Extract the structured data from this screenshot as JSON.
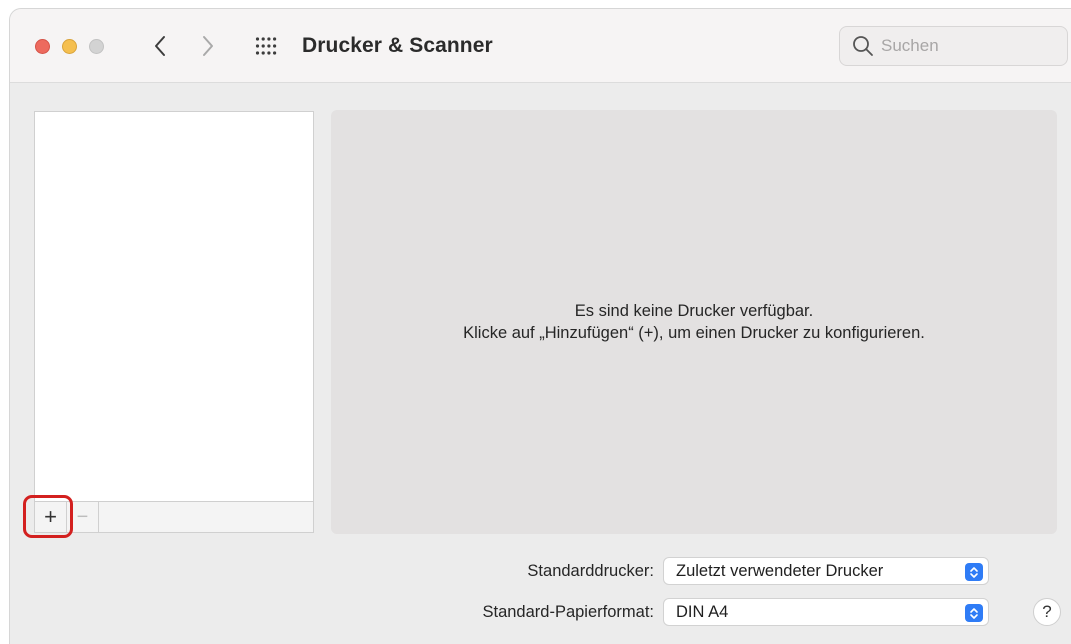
{
  "window": {
    "title": "Drucker & Scanner"
  },
  "search": {
    "placeholder": "Suchen"
  },
  "list_toolbar": {
    "add_label": "+",
    "remove_label": "−"
  },
  "detail": {
    "line1": "Es sind keine Drucker verfügbar.",
    "line2": "Klicke auf „Hinzufügen“ (+), um einen Drucker zu konfigurieren."
  },
  "settings": {
    "default_printer_label": "Standarddrucker:",
    "default_printer_value": "Zuletzt verwendeter Drucker",
    "paper_size_label": "Standard-Papierformat:",
    "paper_size_value": "DIN A4"
  },
  "help": {
    "label": "?"
  },
  "colors": {
    "accent": "#2f7cf6",
    "highlight": "#d3201f",
    "close": "#ed6a5e",
    "minimize": "#f5bf4f",
    "maximize": "#d3d3d3"
  },
  "icons": [
    "search-icon",
    "chevron-left-icon",
    "chevron-right-icon",
    "grid-icon",
    "updown-chevron-icon"
  ]
}
